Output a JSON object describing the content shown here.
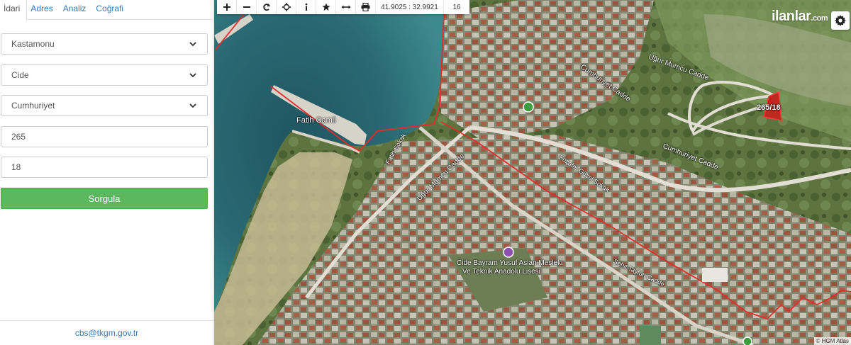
{
  "tabs": [
    {
      "label": "İdari",
      "active": true
    },
    {
      "label": "Adres",
      "active": false
    },
    {
      "label": "Analiz",
      "active": false
    },
    {
      "label": "Coğrafi",
      "active": false
    }
  ],
  "form": {
    "province": "Kastamonu",
    "district": "Cide",
    "neighborhood": "Cumhuriyet",
    "block": "265",
    "parcel": "18",
    "submit_label": "Sorgula"
  },
  "footer": {
    "email": "cbs@tkgm.gov.tr"
  },
  "toolbar": {
    "tools": [
      "zoom-in-icon",
      "zoom-out-icon",
      "refresh-icon",
      "locate-icon",
      "info-icon",
      "star-icon",
      "measure-icon",
      "print-icon"
    ],
    "coordinates": "41.9025 : 32.9921",
    "zoom_level": "16"
  },
  "watermark": {
    "brand": "ilanlar",
    "suffix": ".com"
  },
  "map": {
    "parcel_label": "265/18",
    "labels": {
      "fatih_cami": "Fatih Camii",
      "ugur_mumcu_1": "Uğur Mumcu Cadde",
      "ugur_mumcu_2": "Uğur Mumcu Cadde",
      "cumhuriyet_1": "Cumhuriyet Cadde",
      "cumhuriyet_2": "Cumhuriyet Cadde",
      "school_1": "Cide Bayram Yusuf Aslan Mesleki",
      "school_2": "Ve Teknik Anadolu Lisesi",
      "fatih_sokak": "Fatih Sokak",
      "sehit": "Şehit Tayfun Cadde",
      "izzet": "Fuzafer Güzel Sokak"
    },
    "attribution": "© HGM Atlas"
  },
  "colors": {
    "accent": "#337ab7",
    "button": "#5cb85c",
    "boundary": "#e52b2b"
  }
}
